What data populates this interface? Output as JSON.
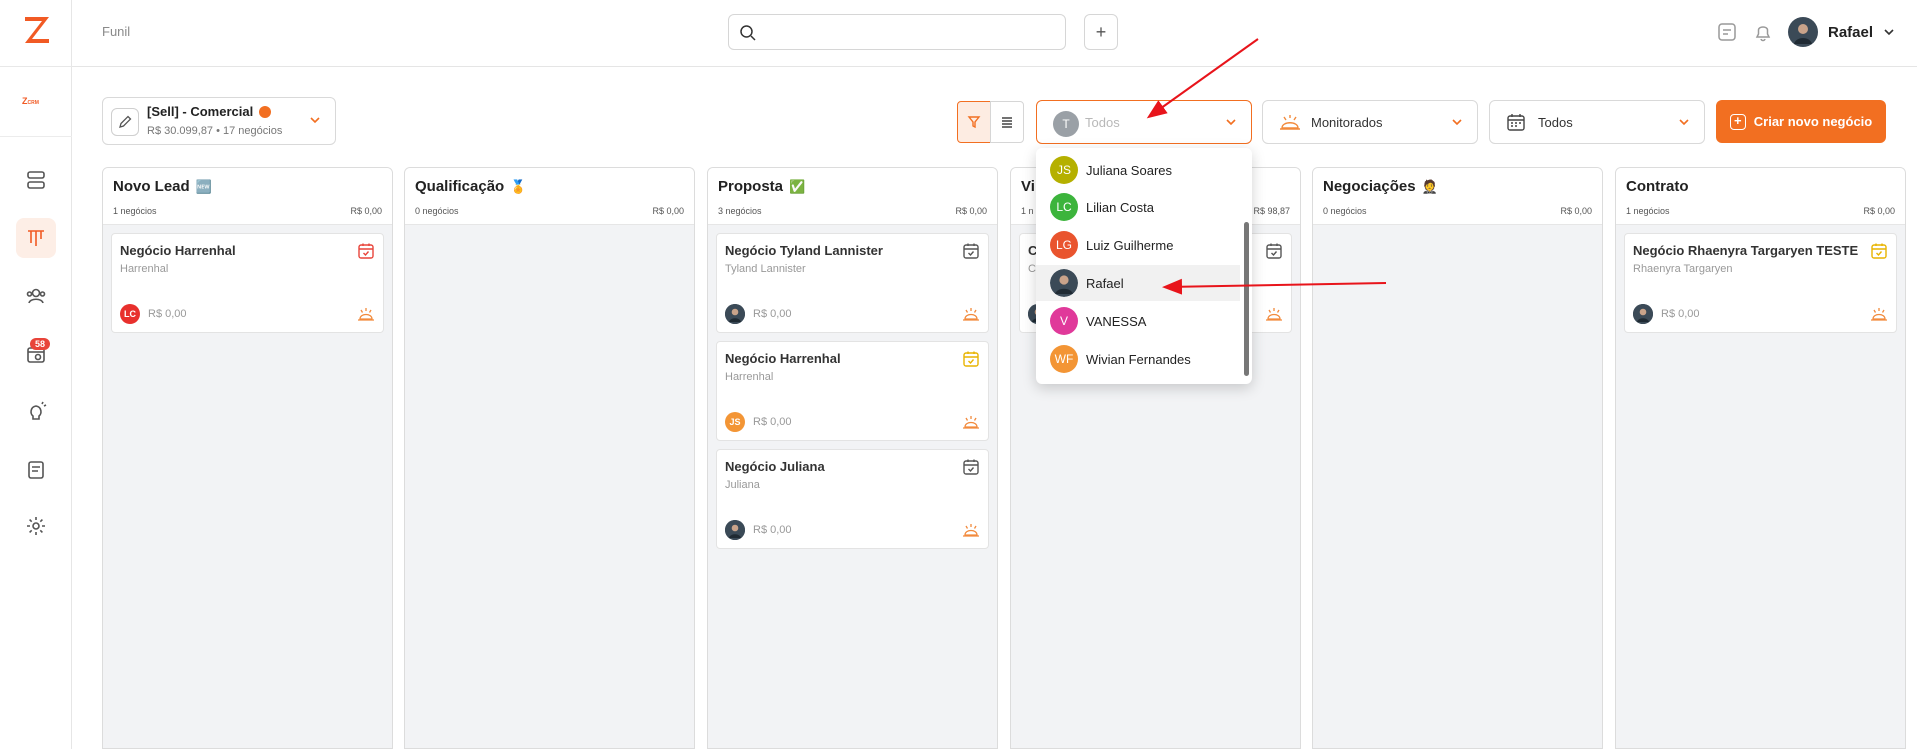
{
  "header": {
    "breadcrumb": "Funil",
    "user_name": "Rafael"
  },
  "sidebar": {
    "crm_label": "Z",
    "crm_small": "CRM",
    "notifications_badge": "58"
  },
  "pipeline": {
    "name": "[Sell] - Comercial",
    "summary": "R$ 30.099,87 • 17 negócios"
  },
  "filters": {
    "owner_initial": "T",
    "owner_placeholder": "Todos",
    "monitor_label": "Monitorados",
    "date_label": "Todos",
    "create_label": "Criar novo negócio"
  },
  "owner_dropdown": [
    {
      "initials": "JS",
      "name": "Juliana Soares",
      "color": "#b5b000"
    },
    {
      "initials": "LC",
      "name": "Lilian Costa",
      "color": "#3cb43c"
    },
    {
      "initials": "LG",
      "name": "Luiz Guilherme",
      "color": "#e9542e"
    },
    {
      "initials": "",
      "name": "Rafael",
      "color": "#3b4a57"
    },
    {
      "initials": "V",
      "name": "VANESSA",
      "color": "#e0399a"
    },
    {
      "initials": "WF",
      "name": "Wivian Fernandes",
      "color": "#f39535"
    }
  ],
  "columns": [
    {
      "title": "Novo Lead",
      "emoji": "🆕",
      "count": "1 negócios",
      "total": "R$ 0,00",
      "cards": [
        {
          "title": "Negócio Harrenhal",
          "subtitle": "Harrenhal",
          "value": "R$ 0,00",
          "avatar": "LC",
          "avatar_color": "#e8302d",
          "cal_color": "#e8443a"
        }
      ]
    },
    {
      "title": "Qualificação",
      "emoji": "🏅",
      "count": "0 negócios",
      "total": "R$ 0,00",
      "cards": []
    },
    {
      "title": "Proposta",
      "emoji": "✅",
      "count": "3 negócios",
      "total": "R$ 0,00",
      "cards": [
        {
          "title": "Negócio Tyland Lannister",
          "subtitle": "Tyland Lannister",
          "value": "R$ 0,00",
          "avatar": "",
          "avatar_color": "#3b4a57",
          "cal_color": "#555555"
        },
        {
          "title": "Negócio Harrenhal",
          "subtitle": "Harrenhal",
          "value": "R$ 0,00",
          "avatar": "JS",
          "avatar_color": "#f39535",
          "cal_color": "#e8b400"
        },
        {
          "title": "Negócio Juliana",
          "subtitle": "Juliana",
          "value": "R$ 0,00",
          "avatar": "",
          "avatar_color": "#3b4a57",
          "cal_color": "#555555"
        }
      ]
    },
    {
      "title": "Vi",
      "emoji": "",
      "count": "1 n",
      "total": "R$ 98,87",
      "cards": [
        {
          "title": "C",
          "subtitle": "C",
          "value": "",
          "avatar": "",
          "avatar_color": "#3b4a57",
          "cal_color": "#555555"
        }
      ]
    },
    {
      "title": "Negociações",
      "emoji": "🤵",
      "count": "0 negócios",
      "total": "R$ 0,00",
      "cards": []
    },
    {
      "title": "Contrato",
      "emoji": "",
      "count": "1 negócios",
      "total": "R$ 0,00",
      "cards": [
        {
          "title": "Negócio Rhaenyra Targaryen TESTE",
          "subtitle": "Rhaenyra Targaryen",
          "value": "R$ 0,00",
          "avatar": "",
          "avatar_color": "#3b4a57",
          "cal_color": "#e8b400"
        }
      ]
    }
  ],
  "colors": {
    "accent": "#f26f21",
    "heat": "#f28a3c"
  }
}
